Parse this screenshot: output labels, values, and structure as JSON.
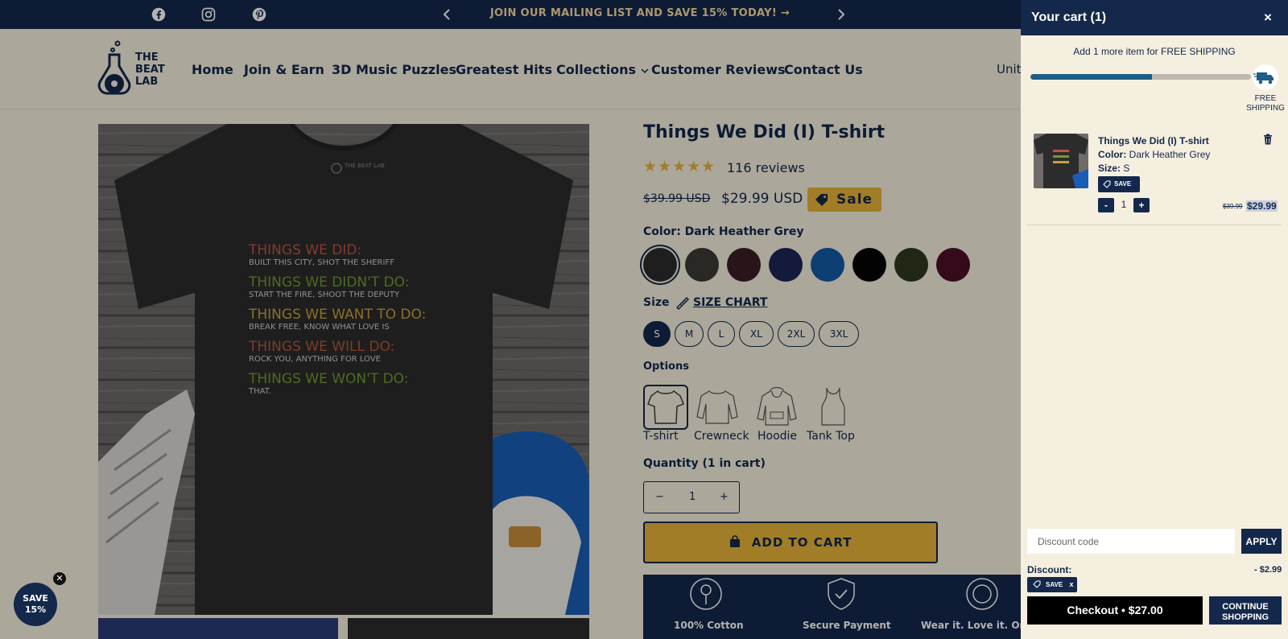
{
  "announcement": {
    "text": "JOIN OUR MAILING LIST AND SAVE 15% TODAY! →"
  },
  "header": {
    "logo_lines": [
      "THE",
      "BEAT",
      "LAB"
    ],
    "nav": [
      {
        "label": "Home"
      },
      {
        "label": "Join & Earn"
      },
      {
        "label": "3D Music Puzzles"
      },
      {
        "label": "Greatest Hits"
      },
      {
        "label": "Collections"
      },
      {
        "label": "Customer Reviews"
      },
      {
        "label": "Contact Us"
      }
    ],
    "locale_label": "Unit"
  },
  "product": {
    "title": "Things We Did (I) T-shirt",
    "stars": "★★★★★",
    "rating": 5,
    "reviews": "116 reviews",
    "old_price": "$39.99 USD",
    "price": "$29.99 USD",
    "sale_label": "Sale",
    "color_label": "Color: Dark Heather Grey",
    "colors": [
      "#2b2b2b",
      "#3b3a36",
      "#3a1f26",
      "#1c2656",
      "#135aa6",
      "#050505",
      "#2e3a1f",
      "#4d0f27"
    ],
    "size_label": "Size",
    "size_chart_label": "SIZE CHART",
    "sizes": [
      "S",
      "M",
      "L",
      "XL",
      "2XL",
      "3XL"
    ],
    "selected_size": "S",
    "options_label": "Options",
    "options": [
      "T-shirt",
      "Crewneck",
      "Hoodie",
      "Tank Top"
    ],
    "quantity_label": "Quantity (1 in cart)",
    "quantity": "1",
    "add_to_cart": "ADD TO CART",
    "shirt_lines": [
      {
        "head": "THINGS WE DID:",
        "sub": "BUILT THIS CITY, SHOT THE SHERIFF",
        "color": "#c0533d"
      },
      {
        "head": "THINGS WE DIDN'T DO:",
        "sub": "START THE FIRE, SHOOT THE DEPUTY",
        "color": "#6f9a2e"
      },
      {
        "head": "THINGS WE WANT TO DO:",
        "sub": "BREAK FREE, KNOW WHAT LOVE IS",
        "color": "#c9a13a"
      },
      {
        "head": "THINGS WE WILL DO:",
        "sub": "ROCK YOU, ANYTHING FOR LOVE",
        "color": "#b8553b"
      },
      {
        "head": "THINGS WE WON'T DO:",
        "sub": "THAT.",
        "color": "#6f9a2e"
      }
    ],
    "shirt_logo": "THE BEAT LAB"
  },
  "trust": {
    "items": [
      "100% Cotton",
      "Secure Payment",
      "Wear it. Love it. Or"
    ]
  },
  "popup": {
    "save_line1": "SAVE",
    "save_line2": "15%"
  },
  "cart": {
    "title": "Your cart (1)",
    "close": "×",
    "shipping_message": "Add 1 more item for FREE SHIPPING",
    "shipping_progress": 0.55,
    "free_shipping_label": "FREE SHIPPING",
    "item": {
      "name": "Things We Did (I) T-shirt",
      "color_key": "Color:",
      "color_value": "Dark Heather Grey",
      "size_key": "Size:",
      "size_value": "S",
      "save_label": "SAVE",
      "minus": "-",
      "plus": "+",
      "quantity": "1",
      "old_price": "$39.99",
      "price": "$29.99"
    },
    "discount_placeholder": "Discount code",
    "apply_label": "APPLY",
    "discount_label": "Discount:",
    "discount_amount": "- $2.99",
    "discount_tag": "SAVE",
    "discount_tag_remove": "x",
    "checkout_label": "Checkout • $27.00",
    "continue_label": "CONTINUE SHOPPING"
  },
  "colors": {
    "navy": "#14284b",
    "cream": "#f5efdf",
    "gold": "#e7b43a",
    "progress": "#1f5d86"
  }
}
